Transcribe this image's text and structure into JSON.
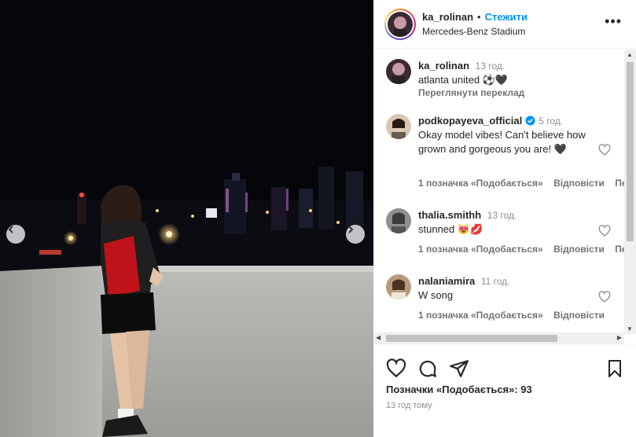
{
  "post": {
    "username": "ka_rolinan",
    "separator": "•",
    "follow_label": "Стежити",
    "location": "Mercedes-Benz Stadium",
    "more_label": "•••"
  },
  "caption": {
    "username": "ka_rolinan",
    "time": "13 год.",
    "text": "atlanta united ⚽🖤",
    "translate_label": "Переглянути переклад"
  },
  "comments": [
    {
      "username": "podkopayeva_official",
      "verified": true,
      "time": "5 год.",
      "text": "Okay model vibes! Can't believe how grown and gorgeous you are! 🖤",
      "likes_label": "1 позначка «Подобається»",
      "reply_label": "Відповісти",
      "translate_label": "Пере"
    },
    {
      "username": "thalia.smithh",
      "verified": false,
      "time": "13 год.",
      "text": "stunned 😻💋",
      "likes_label": "1 позначка «Подобається»",
      "reply_label": "Відповісти",
      "translate_label": "Пере"
    },
    {
      "username": "nalaniamira",
      "verified": false,
      "time": "11 год.",
      "text": "W song",
      "likes_label": "1 позначка «Подобається»",
      "reply_label": "Відповісти"
    }
  ],
  "actions": {
    "icons": [
      "heart-icon",
      "comment-icon",
      "share-icon",
      "bookmark-icon"
    ],
    "likes_text": "Позначки «Подобається»: 93",
    "posted_time": "13 год тому"
  },
  "colors": {
    "accent": "#0095f6",
    "verified": "#0095f6",
    "muted": "#8e8e8e"
  }
}
